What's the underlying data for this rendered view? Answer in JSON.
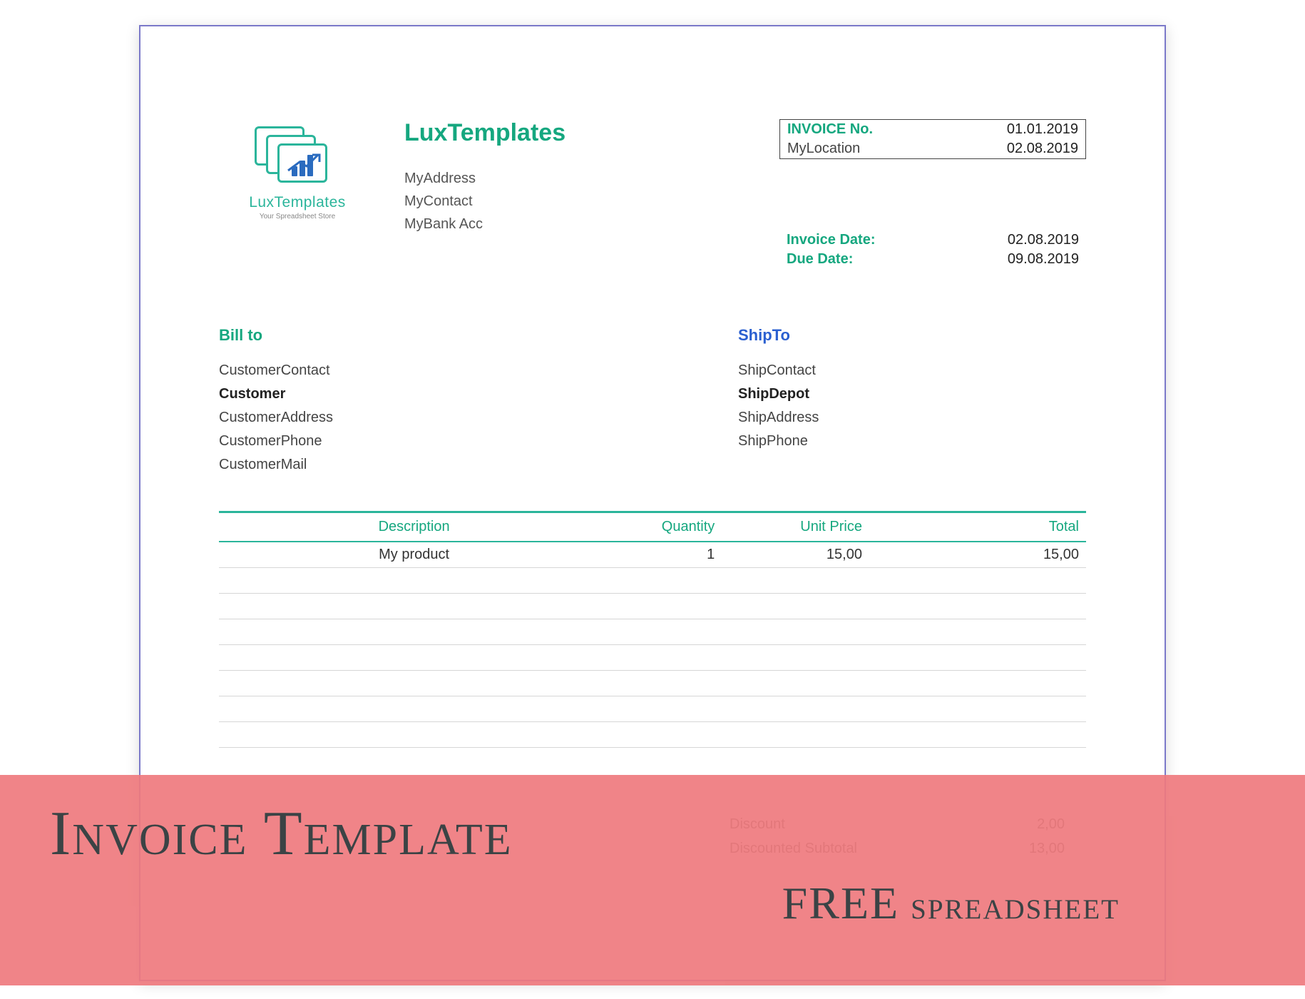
{
  "logo": {
    "brand": "LuxTemplates",
    "tagline": "Your Spreadsheet Store"
  },
  "company": {
    "name": "LuxTemplates",
    "address": "MyAddress",
    "contact": "MyContact",
    "bank": "MyBank Acc"
  },
  "meta": {
    "invoice_no_label": "INVOICE No.",
    "invoice_no_value": "01.01.2019",
    "location_label": "MyLocation",
    "location_value": "02.08.2019"
  },
  "dates": {
    "invoice_date_label": "Invoice Date:",
    "invoice_date_value": "02.08.2019",
    "due_date_label": "Due Date:",
    "due_date_value": "09.08.2019"
  },
  "bill_to": {
    "title": "Bill to",
    "contact": "CustomerContact",
    "name": "Customer",
    "address": "CustomerAddress",
    "phone": "CustomerPhone",
    "mail": "CustomerMail"
  },
  "ship_to": {
    "title": "ShipTo",
    "contact": "ShipContact",
    "name": "ShipDepot",
    "address": "ShipAddress",
    "phone": "ShipPhone"
  },
  "table": {
    "headers": {
      "description": "Description",
      "quantity": "Quantity",
      "unit_price": "Unit Price",
      "total": "Total"
    },
    "rows": [
      {
        "description": "My product",
        "quantity": "1",
        "unit_price": "15,00",
        "total": "15,00"
      },
      {
        "description": "",
        "quantity": "",
        "unit_price": "",
        "total": ""
      },
      {
        "description": "",
        "quantity": "",
        "unit_price": "",
        "total": ""
      },
      {
        "description": "",
        "quantity": "",
        "unit_price": "",
        "total": ""
      },
      {
        "description": "",
        "quantity": "",
        "unit_price": "",
        "total": ""
      },
      {
        "description": "",
        "quantity": "",
        "unit_price": "",
        "total": ""
      },
      {
        "description": "",
        "quantity": "",
        "unit_price": "",
        "total": ""
      },
      {
        "description": "",
        "quantity": "",
        "unit_price": "",
        "total": ""
      }
    ]
  },
  "summary": {
    "discount_label": "Discount",
    "discount_value": "2,00",
    "discounted_subtotal_label": "Discounted Subtotal",
    "discounted_subtotal_value": "13,00"
  },
  "banner": {
    "title": "Invoice Template",
    "subtitle_free": "FREE",
    "subtitle_rest": " spreadsheet"
  }
}
